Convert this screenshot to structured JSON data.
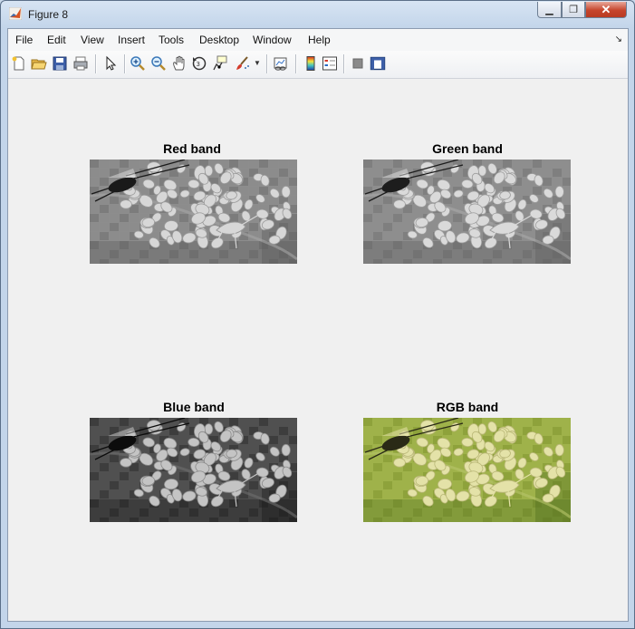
{
  "window": {
    "title": "Figure 8"
  },
  "controls": {
    "minimize": "▁",
    "maximize": "❐",
    "close": "✕"
  },
  "menu": [
    "File",
    "Edit",
    "View",
    "Insert",
    "Tools",
    "Desktop",
    "Window",
    "Help"
  ],
  "toolbar_icons": [
    "new-figure-icon",
    "open-file-icon",
    "save-icon",
    "print-icon",
    "pointer-icon",
    "zoom-in-icon",
    "zoom-out-icon",
    "pan-icon",
    "rotate-3d-icon",
    "data-cursor-icon",
    "brush-icon",
    "link-plot-icon",
    "colorbar-icon",
    "legend-icon",
    "hide-plot-tools-icon",
    "show-plot-tools-icon"
  ],
  "subplots": [
    {
      "title": "Red band",
      "mode": "red"
    },
    {
      "title": "Green band",
      "mode": "green"
    },
    {
      "title": "Blue band",
      "mode": "blue"
    },
    {
      "title": "RGB band",
      "mode": "rgb"
    }
  ],
  "colors": {
    "rgb_bg": "#9fb24a",
    "rgb_egg": "#e4e2a8"
  }
}
